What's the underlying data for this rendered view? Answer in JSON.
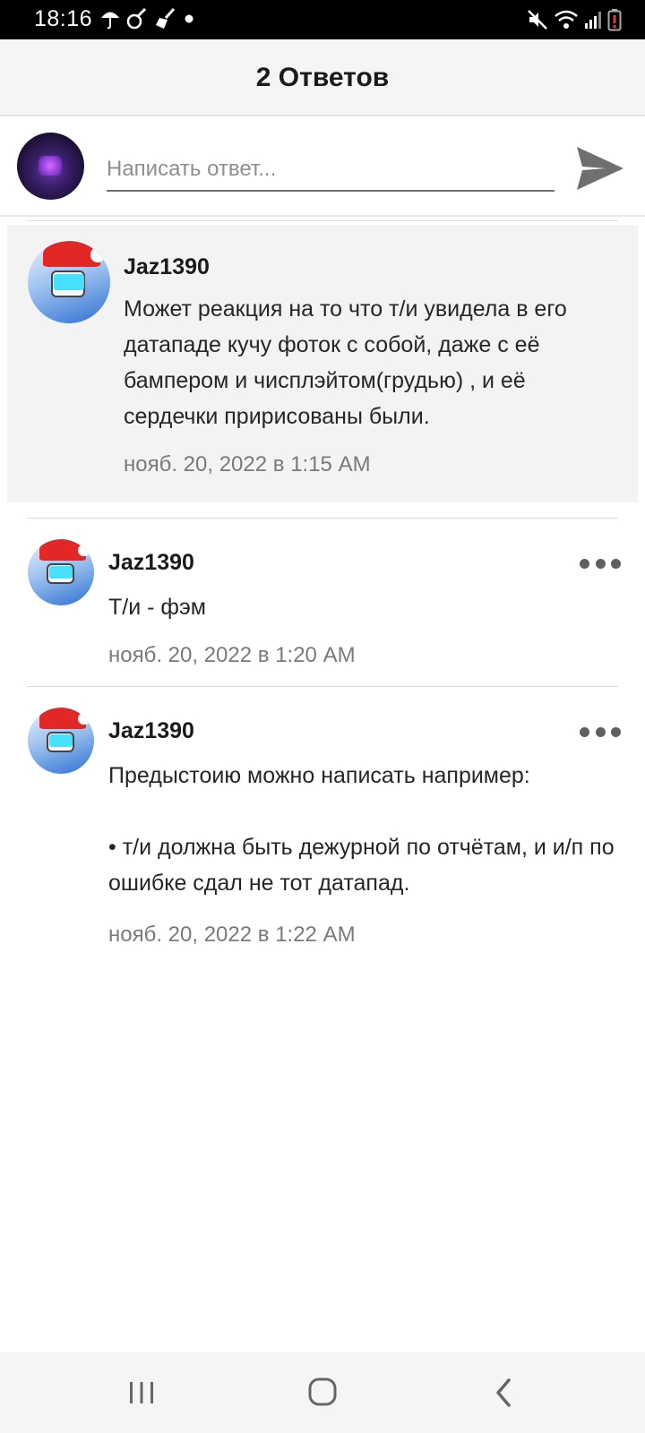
{
  "status_bar": {
    "time": "18:16",
    "left_icons": [
      "umbrella-icon",
      "vacuum-icon",
      "broom-icon",
      "dot-icon"
    ],
    "right_icons": [
      "mute-icon",
      "wifi-icon",
      "signal-icon",
      "battery-low-icon"
    ]
  },
  "header": {
    "title": "2 Ответов"
  },
  "composer": {
    "placeholder": "Написать ответ...",
    "send_icon": "send-icon"
  },
  "comments": [
    {
      "author": "Jaz1390",
      "text": "Может реакция на то что т/и увидела в его датападе кучу фоток с собой, даже с её бампером и чисплэйтом(грудью) , и её сердечки пририсованы были.",
      "timestamp": "нояб. 20, 2022 в 1:15 AM"
    },
    {
      "author": "Jaz1390",
      "text": "Т/и - фэм",
      "timestamp": "нояб. 20, 2022 в 1:20 AM"
    },
    {
      "author": "Jaz1390",
      "text": "Предыстоию можно написать например:\n\n• т/и должна быть дежурной по отчётам, и и/п по ошибке сдал не тот датапад.",
      "timestamp": "нояб. 20, 2022 в 1:22 AM"
    }
  ],
  "nav_bar": {
    "icons": [
      "recent-apps-icon",
      "home-icon",
      "back-icon"
    ]
  },
  "colors": {
    "header_bg": "#f5f5f5",
    "highlight_bg": "#f3f3f3",
    "text": "#262626",
    "muted": "#7a7a7a"
  }
}
